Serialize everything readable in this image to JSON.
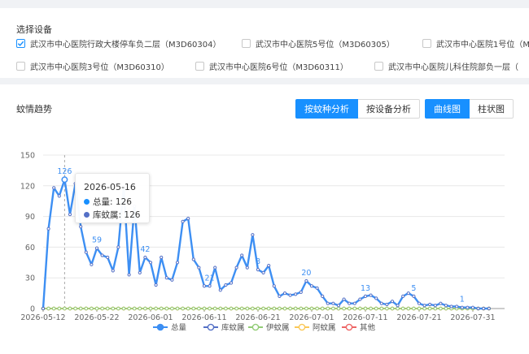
{
  "device_panel": {
    "title": "选择设备",
    "devices": [
      {
        "label": "武汉市中心医院行政大楼停车负二层（M3D60304）",
        "checked": true
      },
      {
        "label": "武汉市中心医院5号位（M3D60305）",
        "checked": false
      },
      {
        "label": "武汉市中心医院1号位（M",
        "checked": false
      },
      {
        "label": "武汉市中心医院3号位（M3D60310）",
        "checked": false
      },
      {
        "label": "武汉市中心医院6号位（M3D60311）",
        "checked": false
      },
      {
        "label": "武汉市中心医院儿科住院部负一层（",
        "checked": false
      }
    ]
  },
  "chart_panel": {
    "title": "蚊情趋势",
    "analysis_buttons": [
      "按蚊种分析",
      "按设备分析"
    ],
    "analysis_active": 0,
    "type_buttons": [
      "曲线图",
      "柱状图"
    ],
    "type_active": 0
  },
  "tooltip": {
    "date": "2026-05-16",
    "rows": [
      {
        "name": "总量",
        "value": "126",
        "color": "#1890ff"
      },
      {
        "name": "库蚊属",
        "value": "126",
        "color": "#5470c6"
      }
    ]
  },
  "chart_data": {
    "type": "line",
    "x_start": "2026-05-12",
    "x_end": "2026-08-03",
    "x_tick_labels": [
      "2026-05-12",
      "2026-05-22",
      "2026-06-01",
      "2026-06-11",
      "2026-06-21",
      "2026-07-01",
      "2026-07-11",
      "2026-07-21",
      "2026-07-31"
    ],
    "y_ticks": [
      0,
      30,
      60,
      90,
      120,
      150
    ],
    "ylim": [
      0,
      150
    ],
    "series": [
      {
        "name": "总量",
        "color": "#3d8ff3",
        "values": [
          0,
          78,
          118,
          110,
          126,
          92,
          122,
          80,
          55,
          43,
          59,
          52,
          50,
          37,
          60,
          119,
          33,
          100,
          35,
          50,
          45,
          23,
          50,
          30,
          28,
          45,
          85,
          88,
          48,
          40,
          22,
          22,
          40,
          18,
          23,
          25,
          40,
          52,
          40,
          72,
          38,
          35,
          42,
          22,
          12,
          15,
          13,
          14,
          16,
          27,
          22,
          20,
          12,
          5,
          5,
          3,
          9,
          5,
          5,
          9,
          12,
          13,
          10,
          5,
          4,
          7,
          3,
          12,
          15,
          12,
          5,
          3,
          4,
          3,
          5,
          3,
          2,
          2,
          1,
          1,
          1,
          0,
          0,
          0
        ],
        "labels": [
          {
            "index": 4,
            "text": "126"
          },
          {
            "index": 10,
            "text": "59"
          },
          {
            "index": 19,
            "text": "42"
          },
          {
            "index": 31,
            "text": "21"
          },
          {
            "index": 40,
            "text": "8"
          },
          {
            "index": 49,
            "text": "20"
          },
          {
            "index": 60,
            "text": "13"
          },
          {
            "index": 69,
            "text": "5"
          },
          {
            "index": 78,
            "text": "1"
          }
        ]
      },
      {
        "name": "库蚊属",
        "color": "#5470c6",
        "values": "same_as_total"
      },
      {
        "name": "伊蚊属",
        "color": "#91cc75",
        "values": "all_zero"
      },
      {
        "name": "阿蚊属",
        "color": "#fac858",
        "values": "all_zero"
      },
      {
        "name": "其他",
        "color": "#ee6666",
        "values": "all_zero"
      }
    ],
    "legend": [
      "总量",
      "库蚊属",
      "伊蚊属",
      "阿蚊属",
      "其他"
    ],
    "legend_position": "bottom",
    "hover_index": 4,
    "grid": true
  }
}
